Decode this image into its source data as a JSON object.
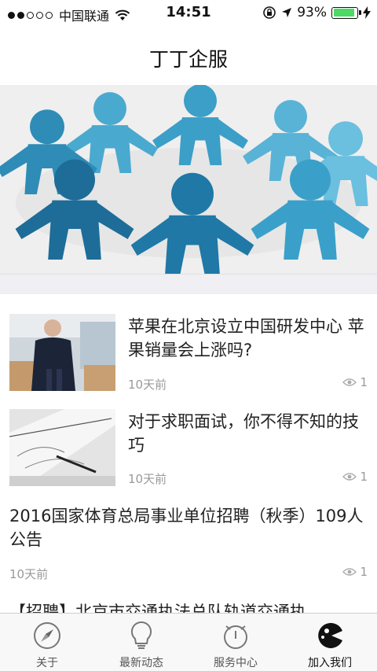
{
  "status": {
    "carrier": "中国联通",
    "time": "14:51",
    "battery_percent": "93%",
    "battery_level": 0.93,
    "signal_bars_filled": 2,
    "signal_bars_total": 5
  },
  "navbar": {
    "title": "丁丁企服"
  },
  "banner": {
    "icon": "people-circle-image"
  },
  "articles": [
    {
      "title": "苹果在北京设立中国研发中心 苹果销量会上涨吗?",
      "time": "10天前",
      "views": "1",
      "thumb": "tim-cook-photo"
    },
    {
      "title": "对于求职面试，你不得不知的技巧",
      "time": "10天前",
      "views": "1",
      "thumb": "sketch-notebook-photo"
    },
    {
      "title": "2016国家体育总局事业单位招聘（秋季）109人公告",
      "time": "10天前",
      "views": "1"
    },
    {
      "title": "【招聘】北京市交通执法总队轨道交通执"
    }
  ],
  "tabs": [
    {
      "label": "关于",
      "icon": "compass-icon"
    },
    {
      "label": "最新动态",
      "icon": "lightbulb-icon"
    },
    {
      "label": "服务中心",
      "icon": "clock-icon"
    },
    {
      "label": "加入我们",
      "icon": "pacman-icon"
    }
  ],
  "colors": {
    "accent": "#2a9fc4",
    "battery": "#4cd964",
    "muted": "#9a9a9a"
  }
}
